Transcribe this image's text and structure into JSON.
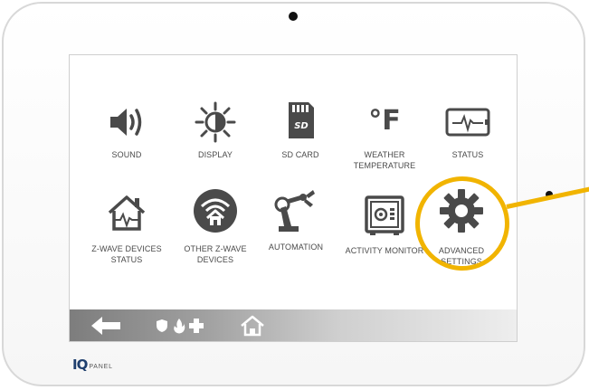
{
  "device": {
    "brand_mark": "IQ",
    "brand_sub": "PANEL"
  },
  "menu": {
    "items": [
      {
        "label": "SOUND",
        "icon": "speaker-icon"
      },
      {
        "label": "DISPLAY",
        "icon": "brightness-icon"
      },
      {
        "label": "SD CARD",
        "icon": "sd-card-icon"
      },
      {
        "label": "WEATHER\nTEMPERATURE",
        "icon": "fahrenheit-icon",
        "glyph": "°F"
      },
      {
        "label": "STATUS",
        "icon": "status-monitor-icon"
      },
      {
        "label": "Z-WAVE DEVICES\nSTATUS",
        "icon": "house-pulse-icon"
      },
      {
        "label": "OTHER Z-WAVE\nDEVICES",
        "icon": "wifi-house-icon"
      },
      {
        "label": "AUTOMATION",
        "icon": "robot-arm-icon"
      },
      {
        "label": "ACTIVITY MONITOR",
        "icon": "safe-icon"
      },
      {
        "label": "ADVANCED\nSETTINGS",
        "icon": "gear-icon"
      }
    ]
  },
  "navbar": {
    "back_icon": "back-arrow-icon",
    "emergency_icons": [
      "shield-icon",
      "flame-icon",
      "medical-cross-icon"
    ],
    "home_icon": "home-icon"
  },
  "colors": {
    "icon": "#4a4a4a",
    "highlight": "#f1b400",
    "brand": "#1f3f6e"
  }
}
